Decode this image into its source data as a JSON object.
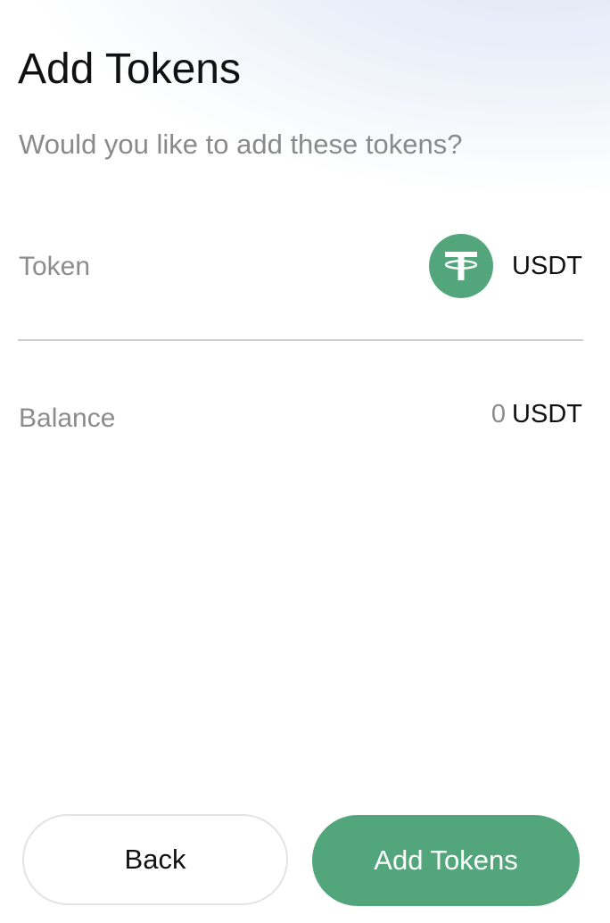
{
  "header": {
    "title": "Add Tokens",
    "subtitle": "Would you like to add these tokens?"
  },
  "token_row": {
    "label": "Token",
    "symbol": "USDT",
    "icon": "tether-icon",
    "icon_color": "#53a67b"
  },
  "balance_row": {
    "label": "Balance",
    "amount": "0",
    "unit": "USDT"
  },
  "actions": {
    "back_label": "Back",
    "add_label": "Add Tokens",
    "accent_color": "#53a67b"
  }
}
